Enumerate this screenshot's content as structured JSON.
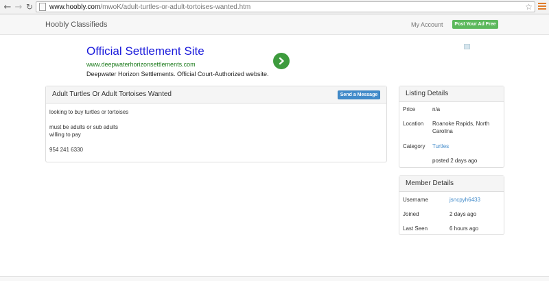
{
  "browser": {
    "url_host": "www.hoobly.com",
    "url_path": "/mwoK/adult-turtles-or-adult-tortoises-wanted.htm"
  },
  "header": {
    "brand": "Hoobly Classifieds",
    "my_account": "My Account",
    "post_ad": "Post Your Ad Free"
  },
  "ad": {
    "title": "Official Settlement Site",
    "url": "www.deepwaterhorizonsettlements.com",
    "description": "Deepwater Horizon Settlements. Official Court-Authorized website."
  },
  "listing": {
    "title": "Adult Turtles Or Adult Tortoises Wanted",
    "send_message": "Send a Message",
    "body": [
      "looking to buy turtles or tortoises",
      "",
      "must be adults or sub adults",
      "willing to pay",
      "",
      "954 241 6330"
    ]
  },
  "listing_details": {
    "heading": "Listing Details",
    "price_label": "Price",
    "price": "n/a",
    "location_label": "Location",
    "location": "Roanoke Rapids, North Carolina",
    "category_label": "Category",
    "category": "Turtles",
    "posted": "posted 2 days ago"
  },
  "member_details": {
    "heading": "Member Details",
    "username_label": "Username",
    "username": "jsncpyh6433",
    "joined_label": "Joined",
    "joined": "2 days ago",
    "last_seen_label": "Last Seen",
    "last_seen": "6 hours ago"
  },
  "colors": {
    "post_ad": "#5cb85c",
    "send_message": "#428bca",
    "ad_title": "#1a1adb",
    "ad_url": "#1b7a1b",
    "ad_arrow": "#3d9b3d",
    "link": "#428bca"
  }
}
